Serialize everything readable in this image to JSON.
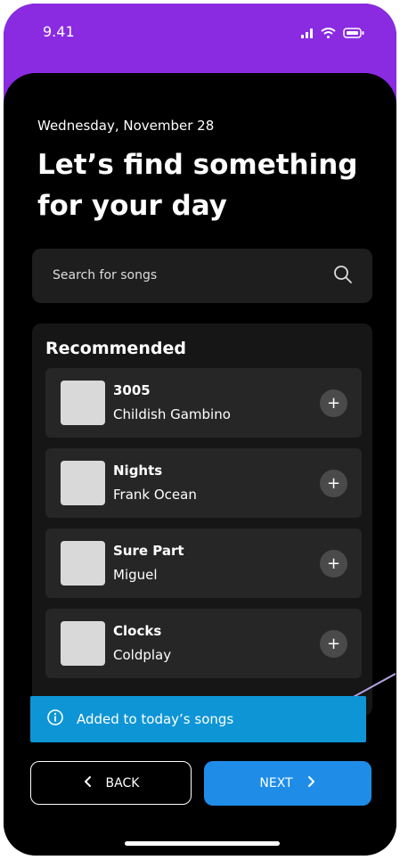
{
  "status_bar": {
    "time": "9.41",
    "icons": [
      "signal-icon",
      "wifi-icon",
      "battery-icon"
    ]
  },
  "header": {
    "date": "Wednesday,  November 28",
    "title": "Let’s find something for your day"
  },
  "search": {
    "placeholder": "Search for songs",
    "icon": "search-icon"
  },
  "recommended": {
    "title": "Recommended",
    "songs": [
      {
        "title": "3005",
        "artist": "Childish Gambino"
      },
      {
        "title": "Nights",
        "artist": "Frank Ocean"
      },
      {
        "title": "Sure Part",
        "artist": "Miguel"
      },
      {
        "title": "Clocks",
        "artist": "Coldplay"
      }
    ],
    "add_label": "+"
  },
  "toast": {
    "text": "Added to today’s songs",
    "icon": "info-icon"
  },
  "nav": {
    "back_label": "BACK",
    "next_label": "NEXT",
    "back_icon": "chevron-left-icon",
    "next_icon": "chevron-right-icon"
  },
  "colors": {
    "header_bg": "#8a2be2",
    "toast_bg": "#0e95d6",
    "primary_button": "#1f8de8",
    "background": "#000000"
  }
}
